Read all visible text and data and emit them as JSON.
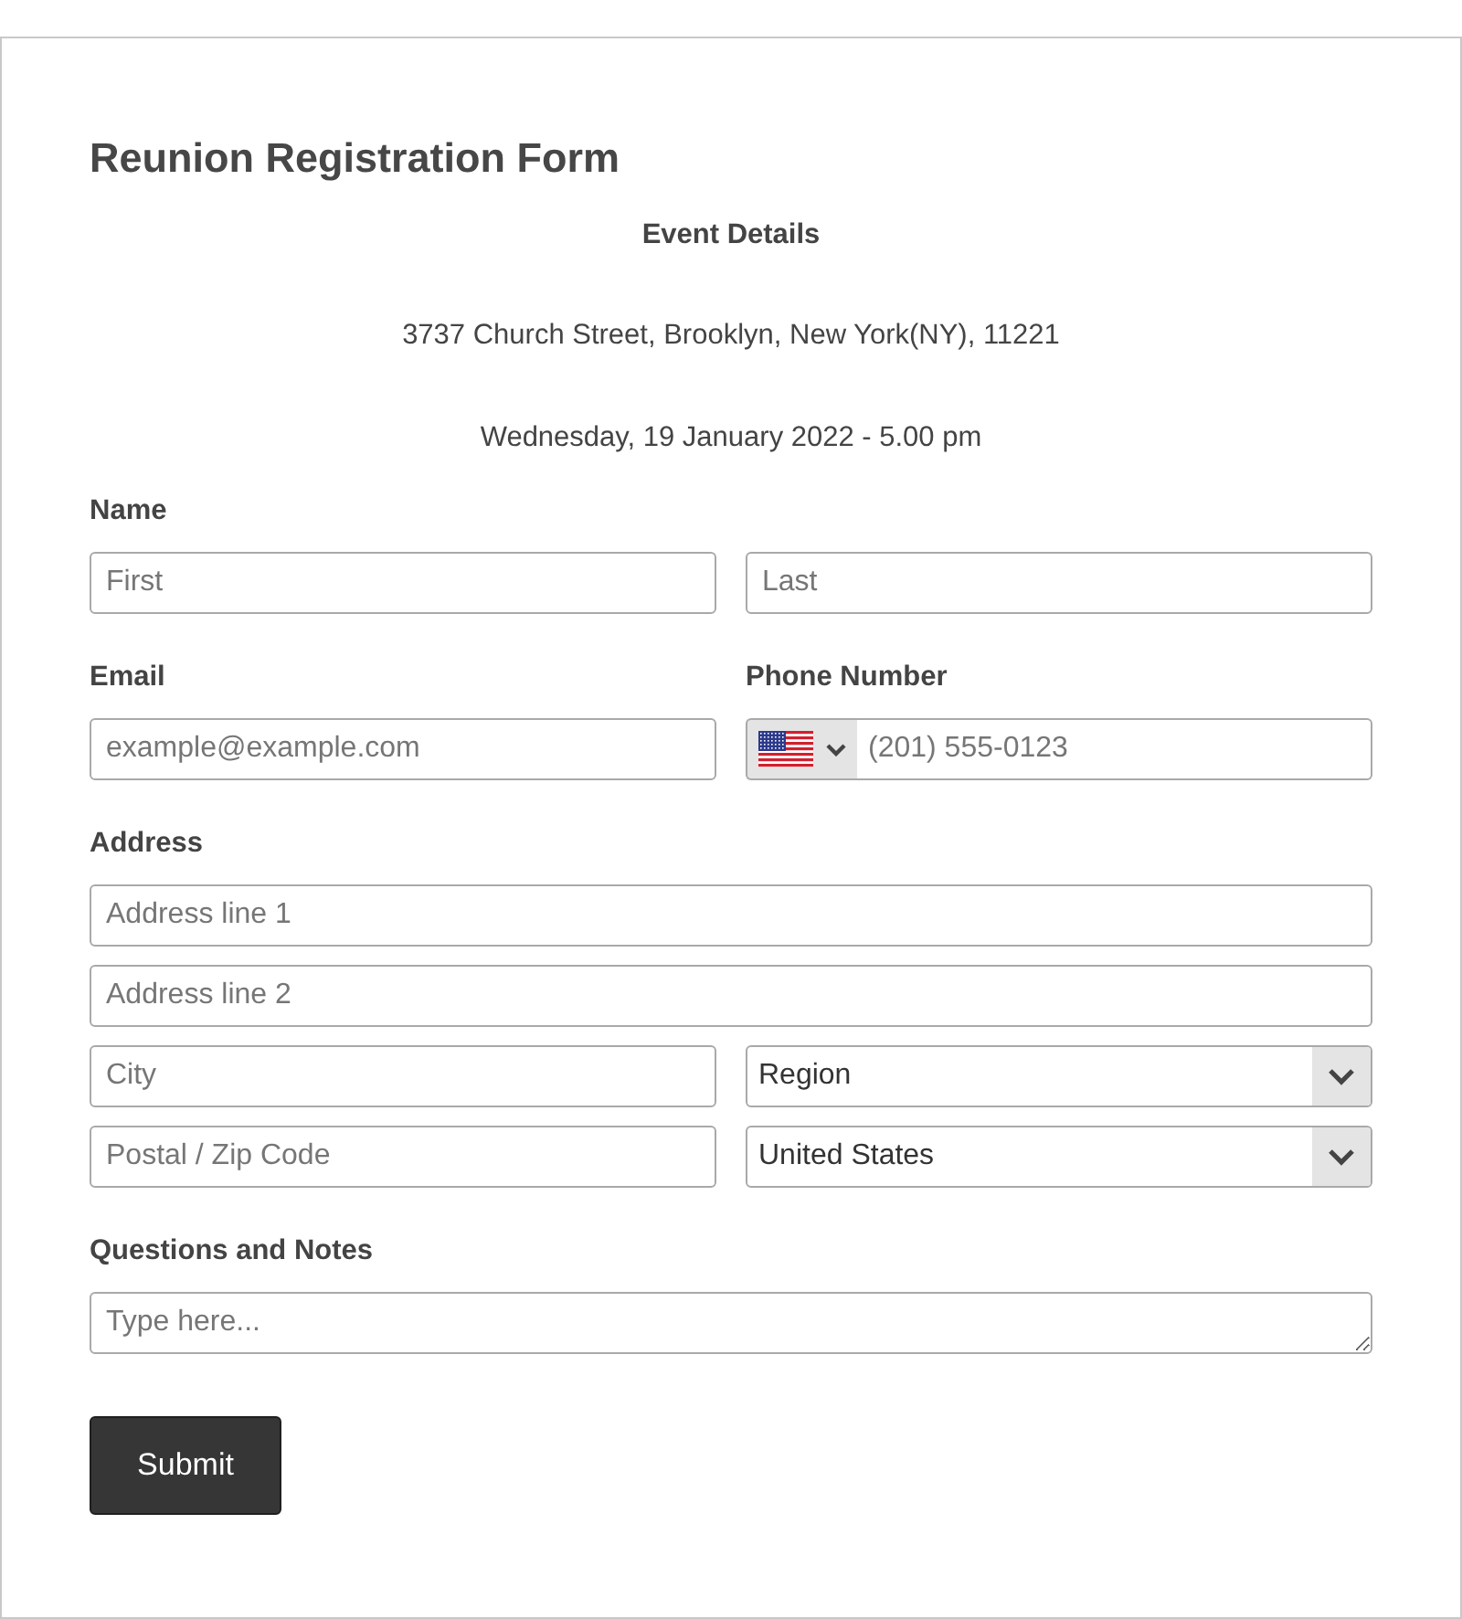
{
  "title": "Reunion Registration Form",
  "event_details": {
    "heading": "Event Details",
    "address": "3737 Church Street, Brooklyn, New York(NY), 11221",
    "datetime": "Wednesday, 19 January 2022 - 5.00 pm"
  },
  "name": {
    "label": "Name",
    "first": {
      "placeholder": "First"
    },
    "last": {
      "placeholder": "Last"
    }
  },
  "email": {
    "label": "Email",
    "placeholder": "example@example.com"
  },
  "phone": {
    "label": "Phone Number",
    "placeholder": "(201) 555-0123"
  },
  "address": {
    "label": "Address",
    "line1": {
      "placeholder": "Address line 1"
    },
    "line2": {
      "placeholder": "Address line 2"
    },
    "city": {
      "placeholder": "City"
    },
    "region": {
      "value": "Region"
    },
    "postal": {
      "placeholder": "Postal / Zip Code"
    },
    "country": {
      "value": "United States"
    }
  },
  "notes": {
    "label": "Questions and Notes",
    "placeholder": "Type here..."
  },
  "submit": {
    "label": "Submit"
  }
}
